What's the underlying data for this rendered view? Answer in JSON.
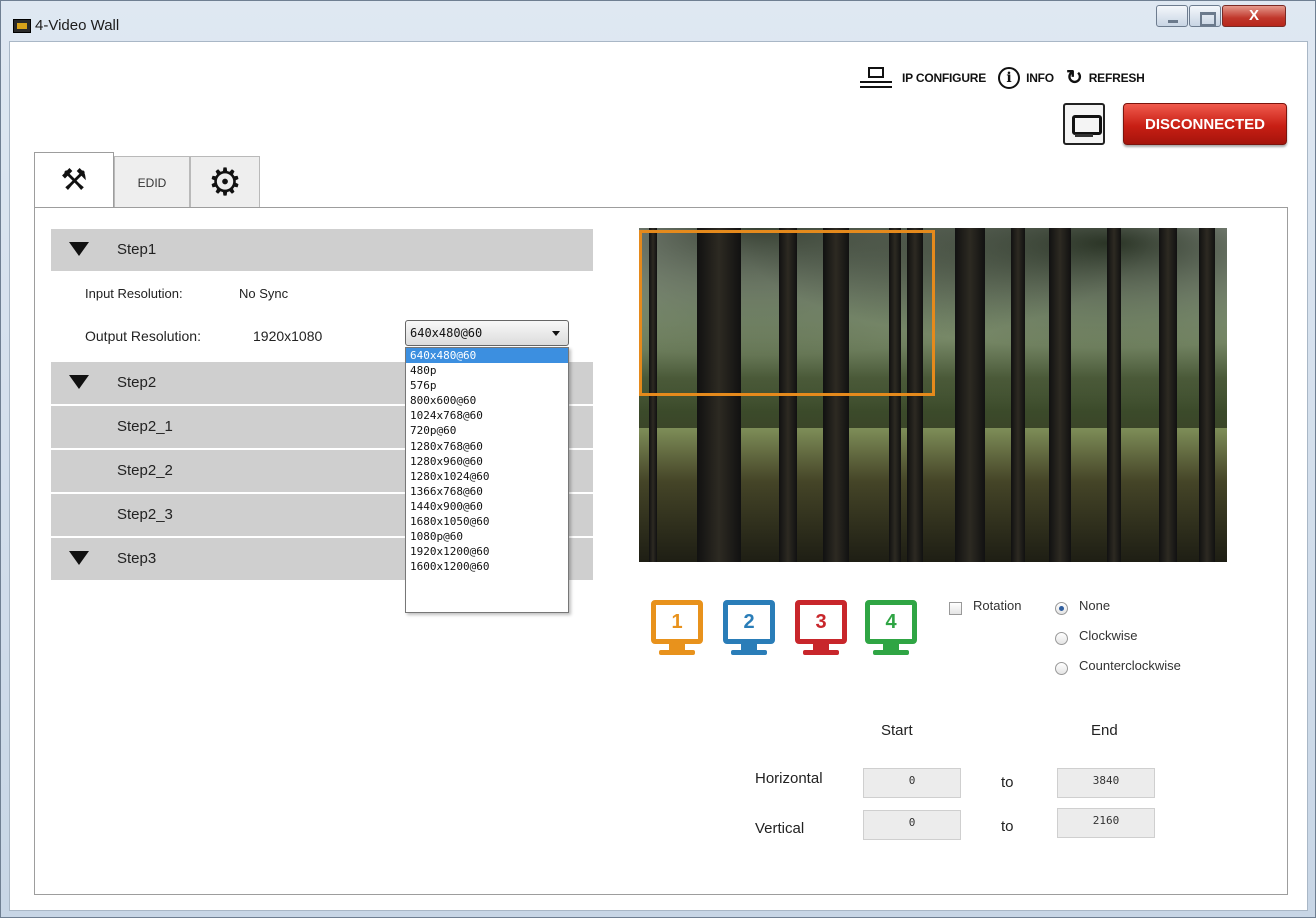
{
  "window": {
    "title": "4-Video Wall",
    "close_glyph": "X"
  },
  "header": {
    "ip_configure_label": "IP CONFIGURE",
    "info_label": "INFO",
    "refresh_label": "REFRESH",
    "refresh_glyph": "↻",
    "info_glyph": "i",
    "connection_status": "DISCONNECTED"
  },
  "tabs": [
    {
      "name": "tools-tab",
      "icon": "tools-icon",
      "glyph": "⚒"
    },
    {
      "name": "edid-tab",
      "label": "EDID"
    },
    {
      "name": "settings-tab",
      "icon": "gear-icon",
      "glyph": "⚙"
    }
  ],
  "steps": {
    "step1": "Step1",
    "step2": "Step2",
    "step2_1": "Step2_1",
    "step2_2": "Step2_2",
    "step2_3": "Step2_3",
    "step3": "Step3"
  },
  "resolution": {
    "input_label": "Input Resolution:",
    "input_value": "No Sync",
    "output_label": "Output Resolution:",
    "output_value": "1920x1080",
    "selected": "640x480@60",
    "options": [
      "640x480@60",
      "480p",
      "576p",
      "800x600@60",
      "1024x768@60",
      "720p@60",
      "1280x768@60",
      "1280x960@60",
      "1280x1024@60",
      "1366x768@60",
      "1440x900@60",
      "1680x1050@60",
      "1080p@60",
      "1920x1200@60",
      "1600x1200@60"
    ]
  },
  "monitors": [
    {
      "number": "1",
      "color": "#e8921c"
    },
    {
      "number": "2",
      "color": "#2a7db8"
    },
    {
      "number": "3",
      "color": "#c8262b"
    },
    {
      "number": "4",
      "color": "#2fa544"
    }
  ],
  "rotation": {
    "label": "Rotation",
    "checked": false,
    "options": [
      "None",
      "Clockwise",
      "Counterclockwise"
    ],
    "selected": "None"
  },
  "coordinates": {
    "start_header": "Start",
    "end_header": "End",
    "horizontal_label": "Horizontal",
    "vertical_label": "Vertical",
    "to_label": "to",
    "h_start": "0",
    "h_end": "3840",
    "v_start": "0",
    "v_end": "2160"
  }
}
